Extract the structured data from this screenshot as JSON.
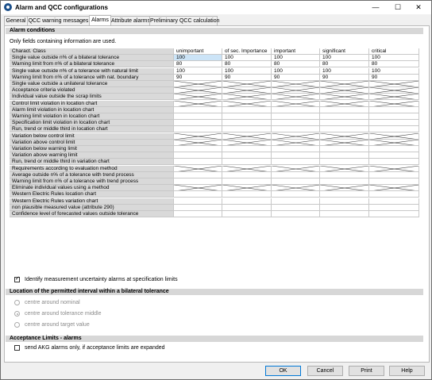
{
  "window": {
    "title": "Alarm and QCC configurations",
    "minimize": "—",
    "maximize": "☐",
    "close": "✕"
  },
  "tabs": [
    "General",
    "QCC warning messages",
    "Alarms",
    "Attribute alarms",
    "Preliminary QCC calculation"
  ],
  "active_tab": "Alarms",
  "alarm_conditions": {
    "title": "Alarm conditions",
    "note": "Only fields containing information are used.",
    "header_label": "Charact. Class",
    "columns": [
      "unimportant",
      "of sec. Importance",
      "important",
      "significant",
      "critical"
    ],
    "rows": [
      {
        "label": "Single value outside n% of a bilateral tolerance",
        "values": [
          "100",
          "100",
          "100",
          "100",
          "100"
        ],
        "crossed": false
      },
      {
        "label": "Warning limit from n% of a bilateral tolerance",
        "values": [
          "80",
          "80",
          "80",
          "80",
          "80"
        ],
        "crossed": false
      },
      {
        "label": "Single value outside n% of a tolerance with natural limit",
        "values": [
          "100",
          "100",
          "100",
          "100",
          "100"
        ],
        "crossed": false
      },
      {
        "label": "Warning limit from n% of a tolerance with nat. boundary",
        "values": [
          "90",
          "90",
          "90",
          "90",
          "90"
        ],
        "crossed": false
      },
      {
        "label": "Single value outside a unilateral tolerance",
        "values": [
          "",
          "",
          "",
          "",
          ""
        ],
        "crossed": true
      },
      {
        "label": "Acceptance criteria violated",
        "values": [
          "",
          "",
          "",
          "",
          ""
        ],
        "crossed": true
      },
      {
        "label": "Individual value outside the scrap limits",
        "values": [
          "",
          "",
          "",
          "",
          ""
        ],
        "crossed": true
      },
      {
        "label": "Control limit violation in location chart",
        "values": [
          "",
          "",
          "",
          "",
          ""
        ],
        "crossed": true
      },
      {
        "label": "Alarm limit violation in location chart",
        "values": [
          "",
          "",
          "",
          "",
          ""
        ],
        "crossed": false
      },
      {
        "label": "Warning  limit violation in location chart",
        "values": [
          "",
          "",
          "",
          "",
          ""
        ],
        "crossed": false
      },
      {
        "label": "Specification limit violation in location chart",
        "values": [
          "",
          "",
          "",
          "",
          ""
        ],
        "crossed": false
      },
      {
        "label": "Run, trend or middle third in location chart",
        "values": [
          "",
          "",
          "",
          "",
          ""
        ],
        "crossed": false
      },
      {
        "label": "Variation below control limit",
        "values": [
          "",
          "",
          "",
          "",
          ""
        ],
        "crossed": true
      },
      {
        "label": "Variation above control limit",
        "values": [
          "",
          "",
          "",
          "",
          ""
        ],
        "crossed": true
      },
      {
        "label": "Variation below warning limit",
        "values": [
          "",
          "",
          "",
          "",
          ""
        ],
        "crossed": false
      },
      {
        "label": "Variation above warning limit",
        "values": [
          "",
          "",
          "",
          "",
          ""
        ],
        "crossed": false
      },
      {
        "label": "Run, trend or middle third in variation chart",
        "values": [
          "",
          "",
          "",
          "",
          ""
        ],
        "crossed": false
      },
      {
        "label": "Requirements according to evaluation method",
        "values": [
          "",
          "",
          "",
          "",
          ""
        ],
        "crossed": true
      },
      {
        "label": "Average outside n% of a tolerance with trend process",
        "values": [
          "",
          "",
          "",
          "",
          ""
        ],
        "crossed": false
      },
      {
        "label": "Warning limit from n% of a tolerance with trend process",
        "values": [
          "",
          "",
          "",
          "",
          ""
        ],
        "crossed": false
      },
      {
        "label": "Eliminate individual values using a method",
        "values": [
          "",
          "",
          "",
          "",
          ""
        ],
        "crossed": true
      },
      {
        "label": "Western Electric Rules location chart",
        "values": [
          "",
          "",
          "",
          "",
          ""
        ],
        "crossed": false
      },
      {
        "label": "Western Electric Rules variation chart",
        "values": [
          "",
          "",
          "",
          "",
          ""
        ],
        "crossed": false
      },
      {
        "label": "non plausible measured value (attribute 290)",
        "values": [
          "",
          "",
          "",
          "",
          ""
        ],
        "crossed": false
      },
      {
        "label": "Confidence level of forecasted values outside tolerance",
        "values": [
          "",
          "",
          "",
          "",
          ""
        ],
        "crossed": false
      }
    ]
  },
  "uncertainty_checkbox": {
    "label": "Identify measurement uncertainty alarms at specification limits",
    "checked": true
  },
  "location_section": {
    "title": "Location of the permitted interval within a bilateral tolerance",
    "options": [
      {
        "label": "centre around nominal",
        "selected": false
      },
      {
        "label": "centre around tolerance middle",
        "selected": true
      },
      {
        "label": "centre around target value",
        "selected": false
      }
    ]
  },
  "acceptance_section": {
    "title": "Acceptance Limits - alarms",
    "checkbox_label": "send AKG alarms only, if acceptance limits are expanded",
    "checked": false
  },
  "buttons": {
    "ok": "OK",
    "cancel": "Cancel",
    "print": "Print",
    "help": "Help"
  }
}
